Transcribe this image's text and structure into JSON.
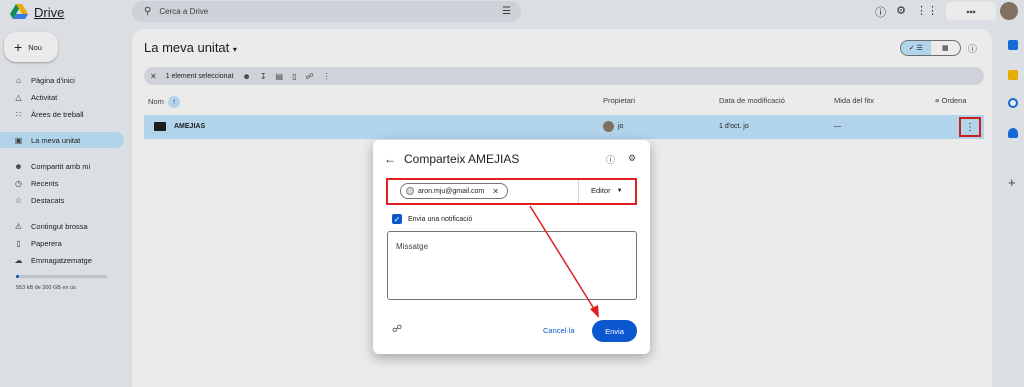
{
  "app": {
    "name": "Drive"
  },
  "search": {
    "placeholder": "Cerca a Drive"
  },
  "sidebar": {
    "new_label": "Nou",
    "items": [
      {
        "label": "Pàgina d'inici",
        "icon": "home-icon"
      },
      {
        "label": "Activitat",
        "icon": "bell-icon"
      },
      {
        "label": "Àrees de treball",
        "icon": "workspaces-icon"
      },
      {
        "label": "La meva unitat",
        "icon": "drive-icon",
        "active": true
      },
      {
        "label": "Compartit amb mi",
        "icon": "people-icon"
      },
      {
        "label": "Recents",
        "icon": "clock-icon"
      },
      {
        "label": "Destacats",
        "icon": "star-icon"
      },
      {
        "label": "Contingut brossa",
        "icon": "spam-icon"
      },
      {
        "label": "Paperera",
        "icon": "trash-icon"
      },
      {
        "label": "Emmagatzematge",
        "icon": "cloud-icon"
      }
    ],
    "storage_text": "553 kB de 300 GB en ús"
  },
  "main": {
    "title": "La meva unitat",
    "selection_text": "1 element seleccionat",
    "columns": {
      "name": "Nom",
      "owner": "Propietari",
      "modified": "Data de modificació",
      "size": "Mida del fitx",
      "sort": "Ordena"
    },
    "rows": [
      {
        "name": "AMEJIAS",
        "owner": "jo",
        "modified": "1 d'oct. jo",
        "size": "—"
      }
    ]
  },
  "dialog": {
    "title": "Comparteix AMEJIAS",
    "chip_email": "aron.mju@gmail.com",
    "role": "Editor",
    "notify_label": "Envia una notificació",
    "message_placeholder": "Missatge",
    "cancel_label": "Cancel·la",
    "send_label": "Envia"
  },
  "colors": {
    "accent": "#0b57d0",
    "selected": "#c2e7ff",
    "annotation": "#e02020"
  }
}
